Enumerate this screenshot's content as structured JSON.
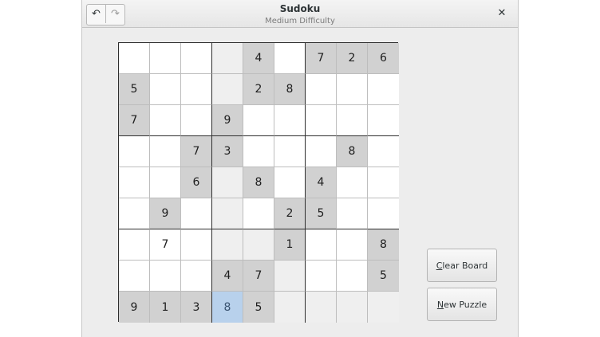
{
  "window": {
    "title": "Sudoku",
    "subtitle": "Medium Difficulty",
    "undo_icon": "↶",
    "redo_icon": "↷",
    "close_icon": "✕"
  },
  "buttons": {
    "clear_board": {
      "mnemonic": "C",
      "rest": "lear Board"
    },
    "new_puzzle": {
      "mnemonic": "N",
      "rest": "ew Puzzle"
    }
  },
  "board": {
    "selected": [
      8,
      3
    ],
    "colors": {
      "given": "#d1d1d1",
      "hint": "#efefef",
      "selected": "#b8d1ec"
    },
    "cells": [
      [
        [
          "",
          ""
        ],
        [
          "",
          ""
        ],
        [
          "",
          ""
        ],
        [
          "",
          "h"
        ],
        [
          "4",
          "g"
        ],
        [
          "",
          ""
        ],
        [
          "7",
          "g"
        ],
        [
          "2",
          "g"
        ],
        [
          "6",
          "g"
        ]
      ],
      [
        [
          "5",
          "g"
        ],
        [
          "",
          ""
        ],
        [
          "",
          ""
        ],
        [
          "",
          "h"
        ],
        [
          "2",
          "g"
        ],
        [
          "8",
          "g"
        ],
        [
          "",
          ""
        ],
        [
          "",
          ""
        ],
        [
          "",
          ""
        ]
      ],
      [
        [
          "7",
          "g"
        ],
        [
          "",
          ""
        ],
        [
          "",
          ""
        ],
        [
          "9",
          "g"
        ],
        [
          "",
          ""
        ],
        [
          "",
          ""
        ],
        [
          "",
          ""
        ],
        [
          "",
          ""
        ],
        [
          "",
          ""
        ]
      ],
      [
        [
          "",
          ""
        ],
        [
          "",
          ""
        ],
        [
          "7",
          "g"
        ],
        [
          "3",
          "g"
        ],
        [
          "",
          ""
        ],
        [
          "",
          ""
        ],
        [
          "",
          ""
        ],
        [
          "8",
          "g"
        ],
        [
          "",
          ""
        ]
      ],
      [
        [
          "",
          ""
        ],
        [
          "",
          ""
        ],
        [
          "6",
          "g"
        ],
        [
          "",
          "h"
        ],
        [
          "8",
          "g"
        ],
        [
          "",
          ""
        ],
        [
          "4",
          "g"
        ],
        [
          "",
          ""
        ],
        [
          "",
          ""
        ]
      ],
      [
        [
          "",
          ""
        ],
        [
          "9",
          "g"
        ],
        [
          "",
          ""
        ],
        [
          "",
          "h"
        ],
        [
          "",
          ""
        ],
        [
          "2",
          "g"
        ],
        [
          "5",
          "g"
        ],
        [
          "",
          ""
        ],
        [
          "",
          ""
        ]
      ],
      [
        [
          "",
          ""
        ],
        [
          "7",
          ""
        ],
        [
          "",
          ""
        ],
        [
          "",
          "h"
        ],
        [
          "",
          "h"
        ],
        [
          "1",
          "g"
        ],
        [
          "",
          ""
        ],
        [
          "",
          ""
        ],
        [
          "8",
          "g"
        ]
      ],
      [
        [
          "",
          ""
        ],
        [
          "",
          ""
        ],
        [
          "",
          ""
        ],
        [
          "4",
          "g"
        ],
        [
          "7",
          "g"
        ],
        [
          "",
          "h"
        ],
        [
          "",
          ""
        ],
        [
          "",
          ""
        ],
        [
          "5",
          "g"
        ]
      ],
      [
        [
          "9",
          "g"
        ],
        [
          "1",
          "g"
        ],
        [
          "3",
          "g"
        ],
        [
          "8",
          "s"
        ],
        [
          "5",
          "g"
        ],
        [
          "",
          "h"
        ],
        [
          "",
          "h"
        ],
        [
          "",
          "h"
        ],
        [
          "",
          "h"
        ]
      ]
    ]
  }
}
